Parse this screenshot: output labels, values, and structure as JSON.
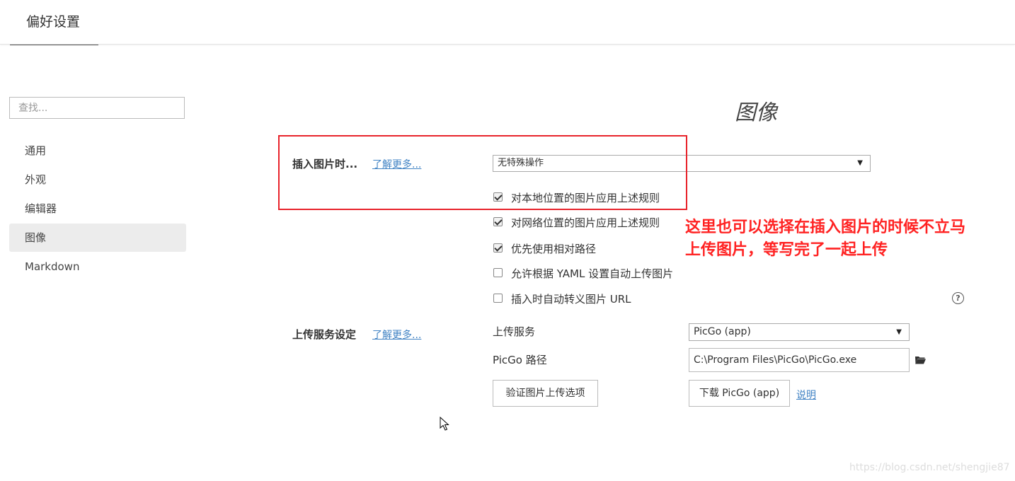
{
  "window": {
    "title": "偏好设置"
  },
  "search": {
    "placeholder": "查找..."
  },
  "sidebar": {
    "items": [
      {
        "label": "通用"
      },
      {
        "label": "外观"
      },
      {
        "label": "编辑器"
      },
      {
        "label": "图像"
      },
      {
        "label": "Markdown"
      }
    ],
    "active_index": 3
  },
  "main": {
    "section_title": "图像",
    "insert_image": {
      "label": "插入图片时...",
      "learn_more": "了解更多...",
      "select_value": "无特殊操作",
      "options": [
        {
          "label": "对本地位置的图片应用上述规则",
          "checked": true
        },
        {
          "label": "对网络位置的图片应用上述规则",
          "checked": true
        },
        {
          "label": "优先使用相对路径",
          "checked": true
        },
        {
          "label": "允许根据 YAML 设置自动上传图片",
          "checked": false
        },
        {
          "label": "插入时自动转义图片 URL",
          "checked": false
        }
      ]
    },
    "upload": {
      "label": "上传服务设定",
      "learn_more": "了解更多...",
      "service_label": "上传服务",
      "service_value": "PicGo (app)",
      "path_label": "PicGo 路径",
      "path_value": "C:\\Program Files\\PicGo\\PicGo.exe",
      "verify_button": "验证图片上传选项",
      "download_button": "下载 PicGo (app)",
      "explain_link": "说明"
    }
  },
  "annotation": {
    "line1": "这里也可以选择在插入图片的时候不立马",
    "line2": "上传图片，等写完了一起上传",
    "color": "#ff2222"
  },
  "watermark": "https://blog.csdn.net/shengjie87",
  "colors": {
    "link": "#4183c4",
    "highlight_box": "#e8232b",
    "active_nav": "#ececec"
  }
}
